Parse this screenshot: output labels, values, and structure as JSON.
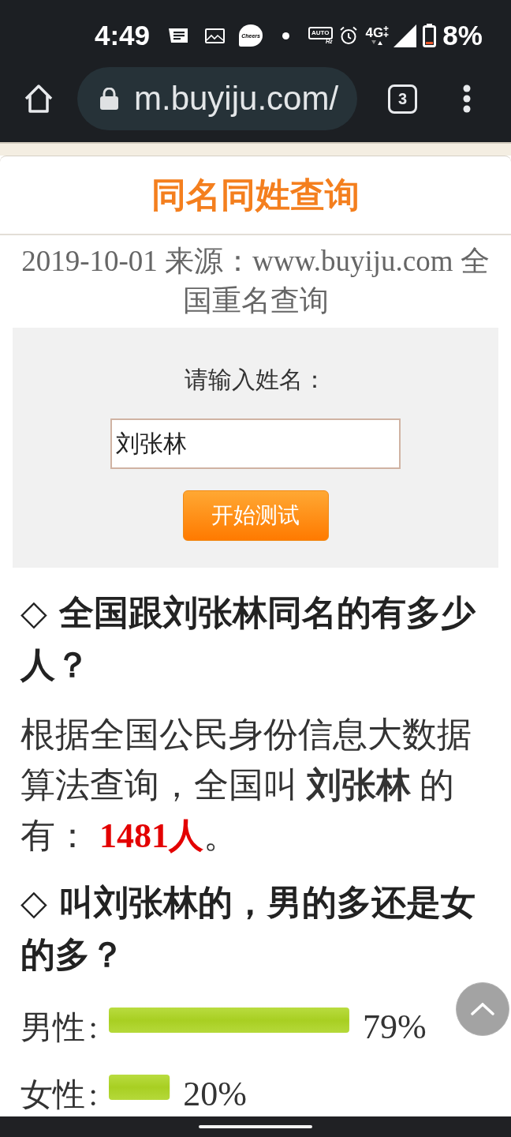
{
  "status_bar": {
    "time": "4:49",
    "app_badge": "Cheers",
    "refresh_rate": {
      "mode": "AUTO",
      "unit": "Hz"
    },
    "network": "4G",
    "battery": "8%"
  },
  "browser": {
    "url": "m.buyiju.com/",
    "tab_count": "3"
  },
  "article": {
    "title": "同名同姓查询",
    "meta": "2019-10-01 来源：www.buyiju.com 全国重名查询"
  },
  "form": {
    "label": "请输入姓名：",
    "input_value": "刘张林",
    "submit_button": "开始测试"
  },
  "sections": [
    {
      "kind": "heading",
      "text": "◇ 全国跟刘张林同名的有多少人？"
    },
    {
      "kind": "paragraph",
      "text": "根据全国公民身份信息大数据算法查询，全国叫 **刘张林** 的有：",
      "highlight": "1481人",
      "tail": "。"
    },
    {
      "kind": "heading",
      "text": "◇ 叫刘张林的，男的多还是女的多？"
    },
    {
      "kind": "chart",
      "label_separator": ":",
      "chart_data": {
        "type": "bar",
        "orientation": "horizontal",
        "categories": [
          "男性",
          "女性"
        ],
        "values": [
          79,
          20
        ],
        "value_labels": [
          "79%",
          "20%"
        ]
      }
    }
  ]
}
